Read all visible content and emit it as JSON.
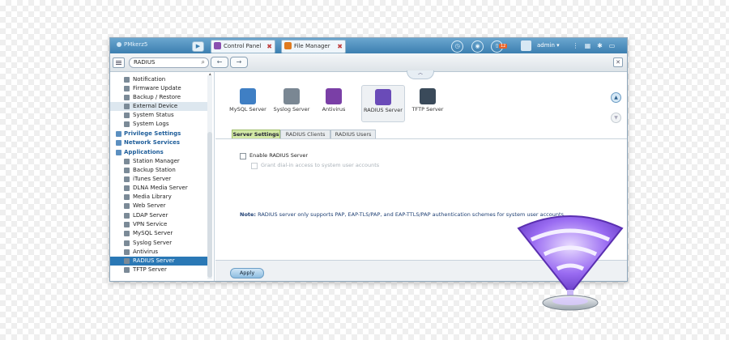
{
  "topbar": {
    "logo_text": "PMkerz5",
    "tabs": [
      {
        "label": "Control Panel",
        "color": "#8a4fb0"
      },
      {
        "label": "File Manager",
        "color": "#e07a1e"
      }
    ],
    "notification_badge": "12",
    "user": "admin",
    "user_chevron": "▾"
  },
  "toolbar": {
    "search_value": "RADIUS",
    "back_icon": "←",
    "forward_icon": "→"
  },
  "sidebar": {
    "items": [
      {
        "label": "Notification",
        "kind": "item"
      },
      {
        "label": "Firmware Update",
        "kind": "item"
      },
      {
        "label": "Backup / Restore",
        "kind": "item"
      },
      {
        "label": "External Device",
        "kind": "item",
        "state": "soft"
      },
      {
        "label": "System Status",
        "kind": "item"
      },
      {
        "label": "System Logs",
        "kind": "item"
      },
      {
        "label": "Privilege Settings",
        "kind": "category"
      },
      {
        "label": "Network Services",
        "kind": "category"
      },
      {
        "label": "Applications",
        "kind": "category"
      },
      {
        "label": "Station Manager",
        "kind": "item"
      },
      {
        "label": "Backup Station",
        "kind": "item"
      },
      {
        "label": "iTunes Server",
        "kind": "item"
      },
      {
        "label": "DLNA Media Server",
        "kind": "item"
      },
      {
        "label": "Media Library",
        "kind": "item"
      },
      {
        "label": "Web Server",
        "kind": "item"
      },
      {
        "label": "LDAP Server",
        "kind": "item"
      },
      {
        "label": "VPN Service",
        "kind": "item"
      },
      {
        "label": "MySQL Server",
        "kind": "item"
      },
      {
        "label": "Syslog Server",
        "kind": "item"
      },
      {
        "label": "Antivirus",
        "kind": "item"
      },
      {
        "label": "RADIUS Server",
        "kind": "item",
        "state": "selected"
      },
      {
        "label": "TFTP Server",
        "kind": "item"
      }
    ]
  },
  "app_icons": [
    {
      "label": "MySQL Server",
      "color": "#3f7fc4"
    },
    {
      "label": "Syslog Server",
      "color": "#7a8793"
    },
    {
      "label": "Antivirus",
      "color": "#7a3fa6"
    },
    {
      "label": "RADIUS Server",
      "color": "#6a4bb8",
      "selected": true
    },
    {
      "label": "TFTP Server",
      "color": "#3a4a5a"
    }
  ],
  "subtabs": [
    {
      "label": "Server Settings",
      "selected": true
    },
    {
      "label": "RADIUS Clients"
    },
    {
      "label": "RADIUS Users"
    }
  ],
  "settings": {
    "enable_label": "Enable RADIUS Server",
    "grant_label": "Grant dial-in access to system user accounts",
    "note_prefix": "Note:",
    "note_text": "RADIUS server only supports PAP, EAP-TLS/PAP, and EAP-TTLS/PAP authentication schemes for system user accounts."
  },
  "footer": {
    "apply_label": "Apply"
  },
  "colors": {
    "accent": "#2a78b5",
    "topbar": "#4a8dbf",
    "subtab_selected": "#d3e9a6",
    "wifi_glow": "#8a5cf0"
  }
}
